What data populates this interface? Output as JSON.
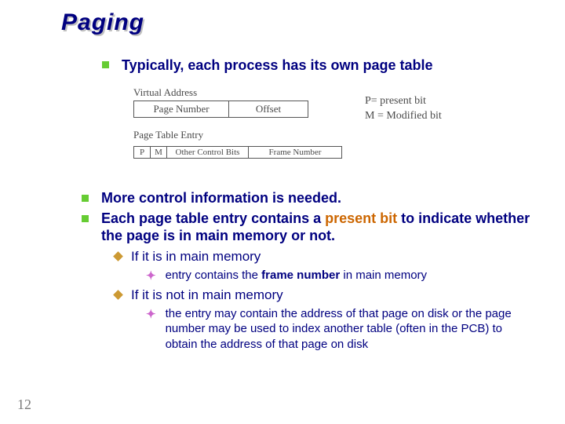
{
  "title": "Paging",
  "bullet_top": "Typically, each process has its own page table",
  "diagram": {
    "va_caption": "Virtual Address",
    "va_cells": {
      "page_number": "Page Number",
      "offset": "Offset"
    },
    "pte_caption": "Page Table Entry",
    "pte_cells": {
      "p": "P",
      "m": "M",
      "ocb": "Other Control Bits",
      "frame": "Frame Number"
    },
    "legend_p": "P= present bit",
    "legend_m": "M = Modified bit"
  },
  "bullets": {
    "b1": "More control information is needed.",
    "b2_pre": "Each page table entry contains a ",
    "b2_accent": "present bit",
    "b2_post": " to indicate whether the page is in main memory or not.",
    "s1a": "If it is in main memory",
    "s2a": "entry contains the ",
    "s2a_bold": "frame number",
    "s2a_post": " in main memory",
    "s1b": "If it is not in main memory",
    "s2b": "the entry may contain the address of that page on disk or the page number may be used to index another table (often in the PCB) to obtain the address of that page on disk"
  },
  "page_number": "12"
}
